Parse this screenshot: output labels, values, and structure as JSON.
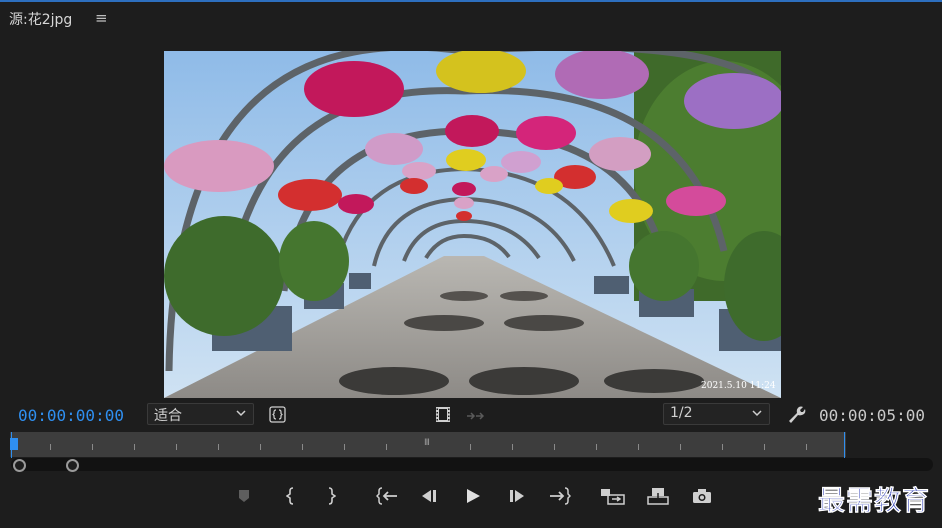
{
  "header": {
    "title": "源:花2jpg",
    "menu_glyph": "≡"
  },
  "monitor": {
    "image_name": "花2jpg",
    "photo_timestamp": "2021.5.10 11:24"
  },
  "timecode": {
    "current": "00:00:00:00",
    "duration": "00:00:05:00"
  },
  "controls": {
    "fit_select": {
      "value": "适合"
    },
    "resolution_select": {
      "value": "1/2"
    },
    "icons": [
      "safe-margins-icon",
      "film-strip-icon",
      "transition-arrows-icon",
      "wrench-icon"
    ]
  },
  "transport": [
    {
      "name": "add-marker-icon",
      "glyph": "⬟"
    },
    {
      "name": "mark-in-icon",
      "glyph": "{"
    },
    {
      "name": "mark-out-icon",
      "glyph": "}"
    },
    {
      "name": "go-to-in-icon",
      "glyph": "{⇤"
    },
    {
      "name": "step-back-icon",
      "glyph": "◂❚"
    },
    {
      "name": "play-icon",
      "glyph": "▶"
    },
    {
      "name": "step-forward-icon",
      "glyph": "❚▸"
    },
    {
      "name": "go-to-out-icon",
      "glyph": "⇥}"
    },
    {
      "name": "insert-icon",
      "glyph": "⇄"
    },
    {
      "name": "overwrite-icon",
      "glyph": "⇩"
    },
    {
      "name": "export-frame-icon",
      "glyph": "📷"
    }
  ],
  "watermark": "最需教育",
  "colors": {
    "accent": "#2f8ff0",
    "background": "#1d1d1d",
    "watermark": "#1c2db0"
  }
}
